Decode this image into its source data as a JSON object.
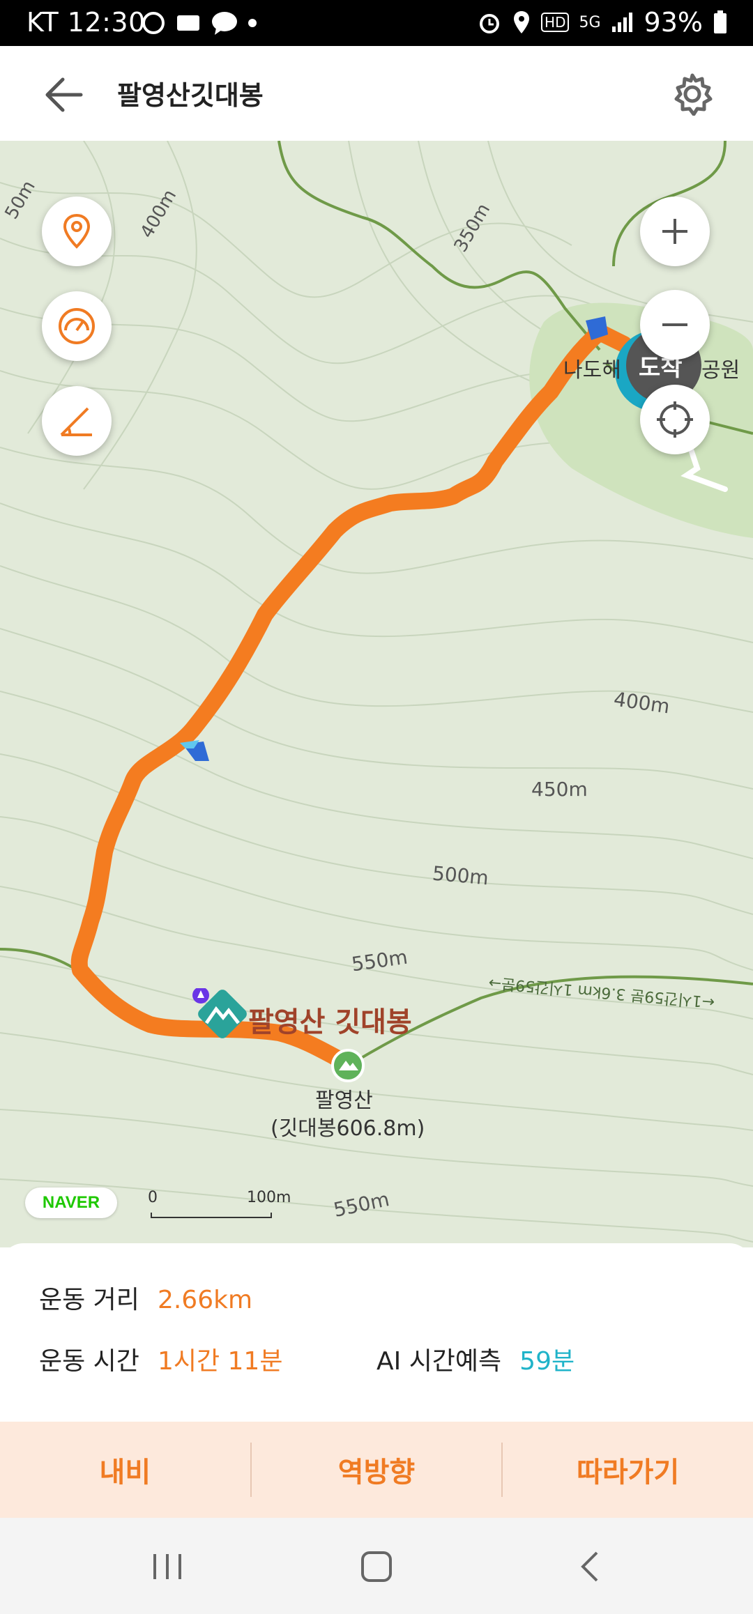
{
  "status_bar": {
    "carrier_time": "KT 12:30",
    "battery": "93%",
    "network": "5G",
    "hd": "HD"
  },
  "header": {
    "title": "팔영산깃대봉"
  },
  "map": {
    "contour_labels": [
      "400m",
      "350m",
      "400m",
      "450m",
      "500m",
      "550m",
      "550m",
      "50m"
    ],
    "destination_label": "도착",
    "park_label_partial": "나도해",
    "park_label_partial2": "공원",
    "poi_name": "팔영산 깃대봉",
    "summit_label_line1": "팔영산",
    "summit_label_line2": "(깃대봉606.8m)",
    "trail_label": "←1시간59분 3.6km 1시간59분→",
    "brand": "NAVER",
    "scale_start": "0",
    "scale_end": "100m"
  },
  "summary": {
    "distance_label": "운동 거리",
    "distance_value": "2.66km",
    "time_label": "운동 시간",
    "time_value": "1시간 11분",
    "ai_label": "AI 시간예측",
    "ai_value": "59분"
  },
  "actions": {
    "navi": "내비",
    "reverse": "역방향",
    "follow": "따라가기"
  },
  "colors": {
    "route": "#f47c20",
    "accent": "#f07b23",
    "teal": "#1fb3c9",
    "map_bg": "#e2ead9",
    "park": "#cfe3bd"
  }
}
